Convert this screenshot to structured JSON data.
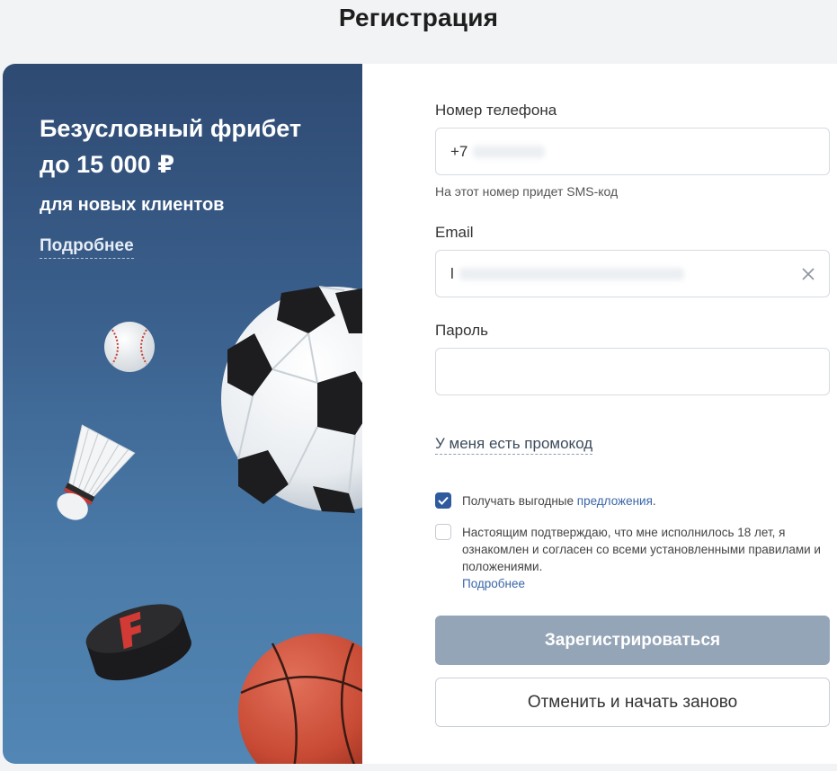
{
  "page": {
    "title": "Регистрация"
  },
  "promo": {
    "headline": "Безусловный фрибет до 15 000 ₽",
    "subtitle": "для новых клиентов",
    "more_label": "Подробнее"
  },
  "form": {
    "phone": {
      "label": "Номер телефона",
      "value": "+7",
      "hint": "На этот номер придет SMS-код"
    },
    "email": {
      "label": "Email",
      "value": "l"
    },
    "password": {
      "label": "Пароль",
      "value": ""
    },
    "promo_code_label": "У меня есть промокод",
    "offers_checkbox": {
      "text": "Получать выгодные ",
      "link": "предложения",
      "suffix": ".",
      "checked": true
    },
    "age_checkbox": {
      "text": "Настоящим подтверждаю, что мне исполнилось 18 лет, я ознакомлен и согласен со всеми установленными правилами и положениями.",
      "checked": false,
      "more_label": "Подробнее"
    },
    "submit_label": "Зарегистрироваться",
    "cancel_label": "Отменить и начать заново"
  },
  "colors": {
    "accent": "#2f5a9e",
    "submit_disabled": "#95a5b8",
    "promo_bg": "#3a5f8c"
  }
}
